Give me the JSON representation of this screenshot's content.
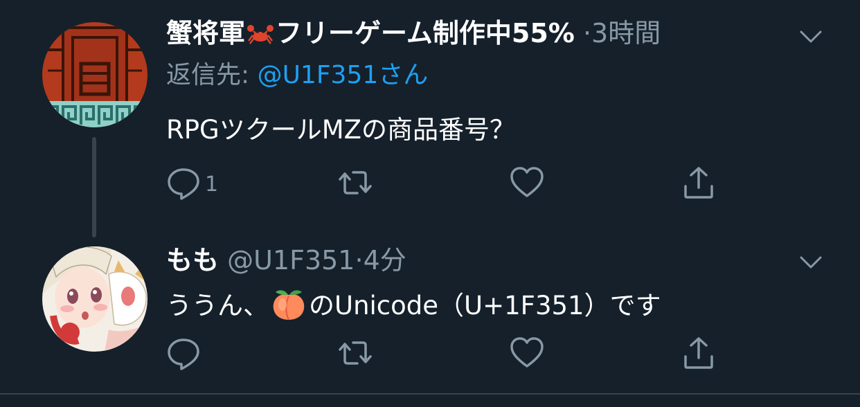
{
  "tweets": [
    {
      "display_name_prefix": "蟹将軍",
      "display_name_suffix": "フリーゲーム制作中55%",
      "separator": "·",
      "time": "3時間",
      "reply_label": "返信先: ",
      "reply_mention": "@U1F351さん",
      "text": "RPGツクールMZの商品番号？",
      "reply_count": "1",
      "icons": [
        "reply-icon",
        "retweet-icon",
        "like-icon",
        "share-icon",
        "chevron-down-icon",
        "crab-emoji"
      ]
    },
    {
      "display_name": "もも",
      "handle": "@U1F351",
      "separator": "·",
      "time": "4分",
      "text_before": "ううん、",
      "text_after": "のUnicode（U+1F351）です",
      "icons": [
        "reply-icon",
        "retweet-icon",
        "like-icon",
        "share-icon",
        "chevron-down-icon",
        "peach-emoji"
      ]
    }
  ],
  "colors": {
    "background": "#15202b",
    "secondary_text": "#8899a6",
    "link": "#1da1f2",
    "divider": "#38444d"
  }
}
